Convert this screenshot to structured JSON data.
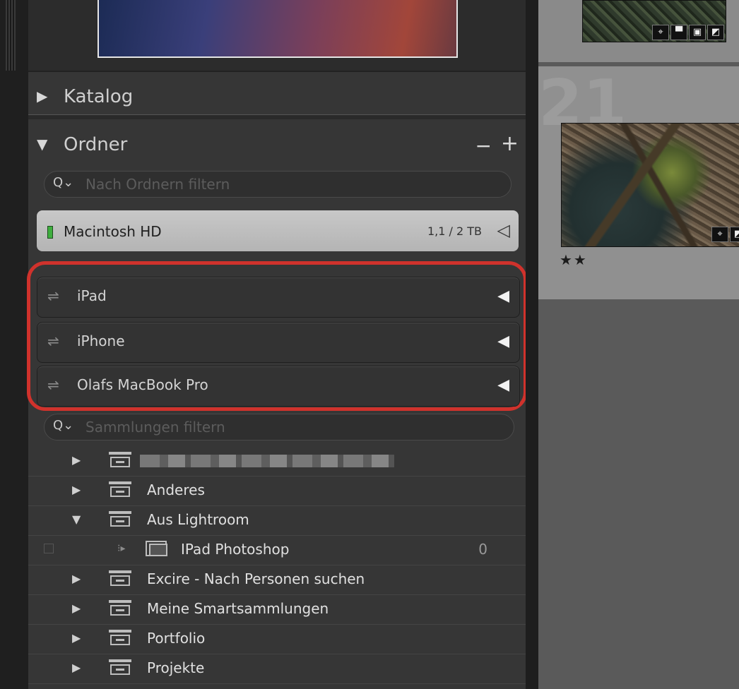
{
  "sections": {
    "katalog": {
      "label": "Katalog"
    },
    "ordner": {
      "label": "Ordner",
      "minus": "−",
      "plus": "+"
    }
  },
  "folder_search": {
    "placeholder": "Nach Ordnern filtern"
  },
  "volume": {
    "name": "Macintosh HD",
    "size": "1,1 / 2 TB"
  },
  "devices": [
    {
      "name": "iPad"
    },
    {
      "name": "iPhone"
    },
    {
      "name": "Olafs MacBook Pro"
    }
  ],
  "collection_search": {
    "placeholder": "Sammlungen filtern"
  },
  "collections": [
    {
      "label": "Anderes"
    },
    {
      "label": "Aus Lightroom"
    },
    {
      "label": "IPad Photoshop",
      "count": "0"
    },
    {
      "label": "Excire - Nach Personen suchen"
    },
    {
      "label": "Meine Smartsammlungen"
    },
    {
      "label": "Portfolio"
    },
    {
      "label": "Projekte"
    }
  ],
  "grid": {
    "cell_number": "21",
    "rating": "★★",
    "rating_value": 2
  },
  "colors": {
    "highlight": "#d0322c",
    "volume_led": "#3fae3f"
  }
}
